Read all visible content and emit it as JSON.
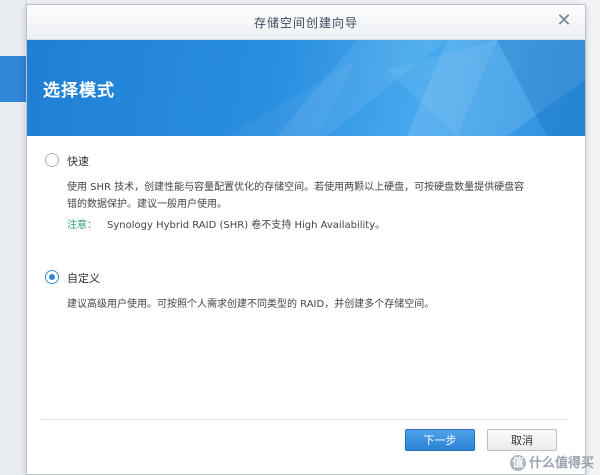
{
  "dialog": {
    "title": "存储空间创建向导",
    "close_icon": "close-icon",
    "step_title": "选择模式"
  },
  "options": {
    "quick": {
      "label": "快速",
      "selected": false,
      "desc_line1": "使用 SHR 技术，创建性能与容量配置优化的存储空间。若使用两颗以上硬盘，可按硬盘数量提供硬盘容",
      "desc_line2": "错的数据保护。建议一般用户使用。",
      "note_label": "注意：",
      "note_text": "Synology Hybrid RAID (SHR) 卷不支持 High Availability。"
    },
    "custom": {
      "label": "自定义",
      "selected": true,
      "desc": "建议高级用户使用。可按照个人需求创建不同类型的 RAID，并创建多个存储空间。"
    }
  },
  "buttons": {
    "next": "下一步",
    "cancel": "取消"
  },
  "watermark": {
    "icon_text": "值",
    "text": "什么值得买"
  },
  "colors": {
    "accent": "#2f86d6",
    "note_green": "#2aa07a"
  }
}
